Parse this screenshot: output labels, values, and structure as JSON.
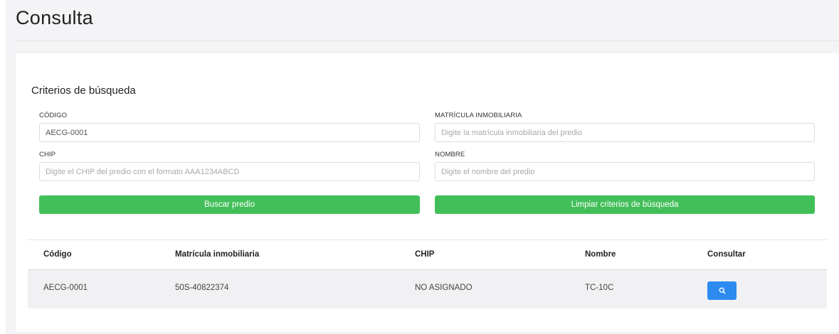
{
  "page": {
    "title": "Consulta"
  },
  "search": {
    "section_title": "Criterios de búsqueda",
    "fields": {
      "codigo": {
        "label": "CÓDIGO",
        "value": "AECG-0001",
        "placeholder": ""
      },
      "matricula": {
        "label": "MATRÍCULA INMOBILIARIA",
        "value": "",
        "placeholder": "Digite la matrícula inmobiliaria del predio"
      },
      "chip": {
        "label": "CHIP",
        "value": "",
        "placeholder": "Digite el CHIP del predio con el formato AAA1234ABCD"
      },
      "nombre": {
        "label": "NOMBRE",
        "value": "",
        "placeholder": "Digite el nombre del predio"
      }
    },
    "buttons": {
      "search_label": "Buscar predio",
      "clear_label": "Limpiar criterios de búsqueda"
    }
  },
  "results": {
    "columns": [
      "Código",
      "Matrícula inmobiliaria",
      "CHIP",
      "Nombre",
      "Consultar"
    ],
    "rows": [
      {
        "codigo": "AECG-0001",
        "matricula": "50S-40822374",
        "chip": "NO ASIGNADO",
        "nombre": "TC-10C",
        "action_icon": "search-icon"
      }
    ]
  },
  "colors": {
    "accent_green": "#43bf5a",
    "accent_blue": "#2d8bf0",
    "row_background": "#f1f1f3"
  }
}
